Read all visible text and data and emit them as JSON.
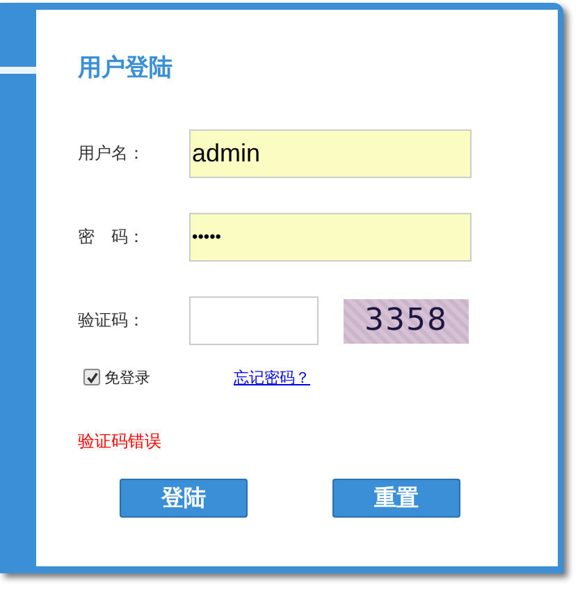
{
  "title": "用户登陆",
  "fields": [
    {
      "label": "用户名：",
      "kind": "text",
      "value": "admin"
    },
    {
      "label": "密　码：",
      "kind": "password",
      "value": "•••••"
    },
    {
      "label": "验证码：",
      "kind": "captcha",
      "captcha": "3358"
    }
  ],
  "remember": {
    "label": "免登录",
    "checked": true
  },
  "forgot_link": "忘记密码？",
  "error": "验证码错误",
  "buttons": [
    "登陆",
    "重置"
  ]
}
